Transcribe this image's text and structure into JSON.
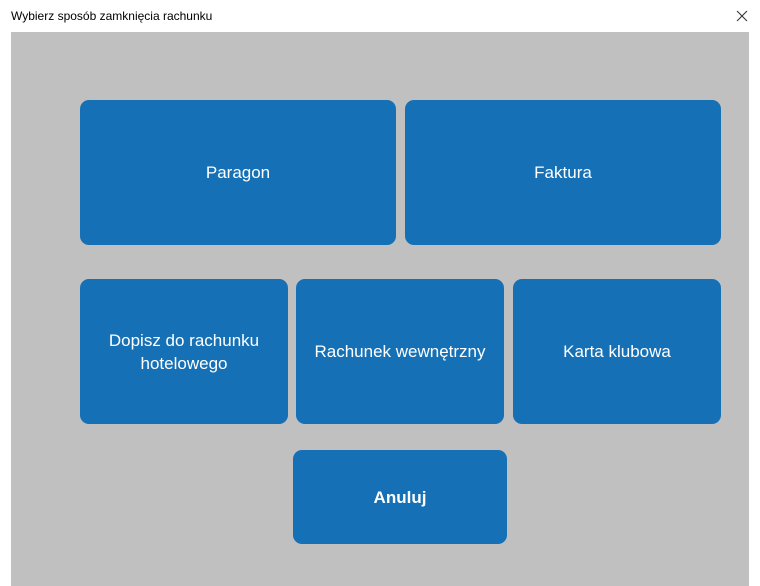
{
  "window": {
    "title": "Wybierz sposób zamknięcia rachunku",
    "close_icon": "close-icon"
  },
  "options": {
    "paragon": "Paragon",
    "faktura": "Faktura",
    "hotel_bill": "Dopisz do rachunku hotelowego",
    "internal_bill": "Rachunek wewnętrzny",
    "club_card": "Karta klubowa",
    "cancel": "Anuluj"
  },
  "colors": {
    "tile": "#1570b5",
    "background": "#c0c0c0",
    "text": "#ffffff"
  }
}
